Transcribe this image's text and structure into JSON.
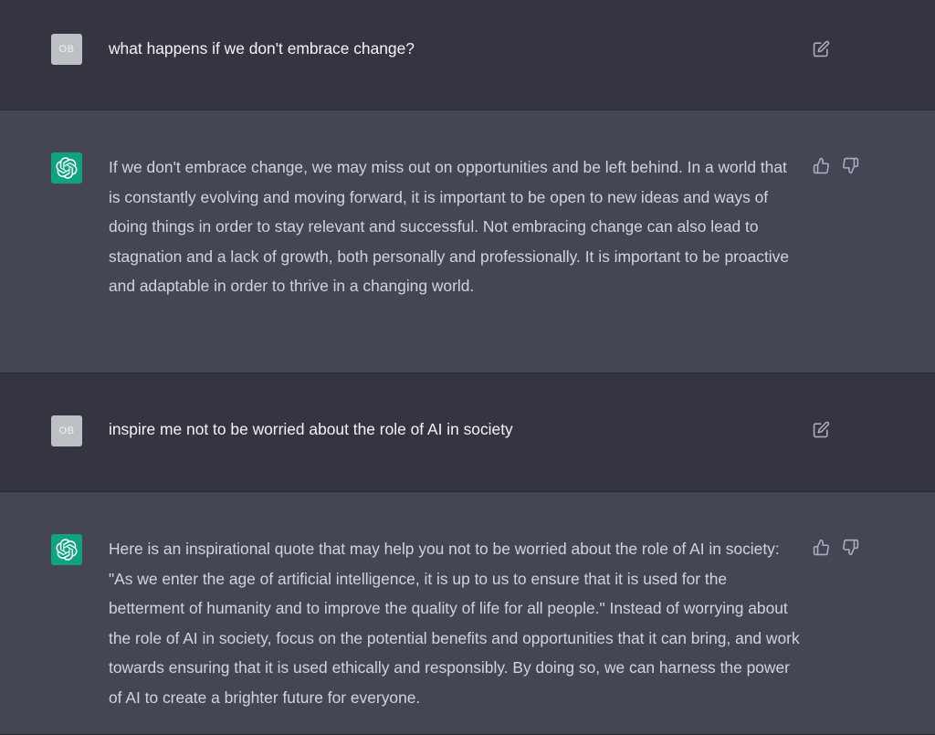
{
  "conversation": [
    {
      "role": "user",
      "avatar_initials": "OB",
      "text": "what happens if we don't embrace change?",
      "actions": [
        "edit-icon"
      ]
    },
    {
      "role": "assistant",
      "avatar_icon": "openai-logo-icon",
      "text": "If we don't embrace change, we may miss out on opportunities and be left behind. In a world that is constantly evolving and moving forward, it is important to be open to new ideas and ways of doing things in order to stay relevant and successful. Not embracing change can also lead to stagnation and a lack of growth, both personally and professionally. It is important to be proactive and adaptable in order to thrive in a changing world.",
      "actions": [
        "thumbs-up-icon",
        "thumbs-down-icon"
      ]
    },
    {
      "role": "user",
      "avatar_initials": "OB",
      "text": "inspire me not to be worried about the role of AI in society",
      "actions": [
        "edit-icon"
      ]
    },
    {
      "role": "assistant",
      "avatar_icon": "openai-logo-icon",
      "text": "Here is an inspirational quote that may help you not to be worried about the role of AI in society: \"As we enter the age of artificial intelligence, it is up to us to ensure that it is used for the betterment of humanity and to improve the quality of life for all people.\" Instead of worrying about the role of AI in society, focus on the potential benefits and opportunities that it can bring, and work towards ensuring that it is used ethically and responsibly. By doing so, we can harness the power of AI to create a brighter future for everyone.",
      "actions": [
        "thumbs-up-icon",
        "thumbs-down-icon"
      ]
    }
  ],
  "colors": {
    "user_bg": "#343541",
    "assistant_bg": "#444654",
    "bot_avatar": "#10a37f",
    "user_avatar": "#bdc1c6",
    "icon": "#acacbe"
  }
}
